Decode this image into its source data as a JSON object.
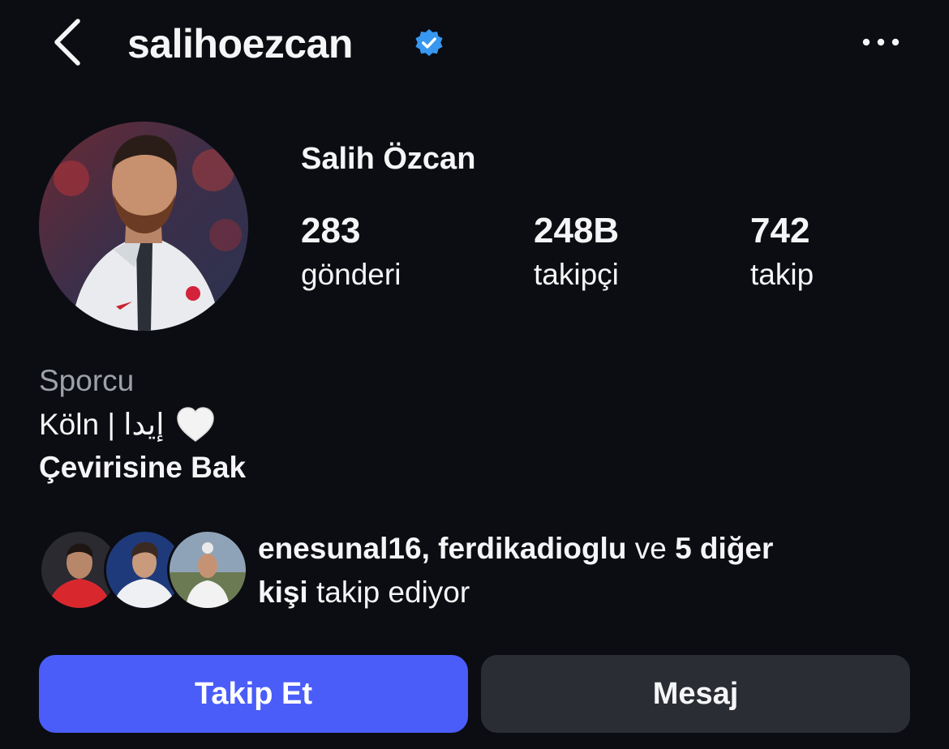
{
  "header": {
    "username": "salihoezcan",
    "back_icon": "chevron-left-icon",
    "verified_icon": "verified-badge-icon",
    "more_icon": "more-horizontal-icon"
  },
  "profile": {
    "full_name": "Salih Özcan",
    "stats": [
      {
        "value": "283",
        "label": "gönderi"
      },
      {
        "value": "248B",
        "label": "takipçi"
      },
      {
        "value": "742",
        "label": "takip"
      }
    ]
  },
  "bio": {
    "category": "Sporcu",
    "text": "Köln | إيدا",
    "heart_icon": "white-heart-icon",
    "translate_link": "Çevirisine Bak"
  },
  "mutual": {
    "user1": "enesunal16",
    "sep": ", ",
    "user2": "ferdikadioglu",
    "and": " ve ",
    "others": "5 diğer",
    "newline_bold": "kişi",
    "tail": " takip ediyor"
  },
  "actions": {
    "follow_label": "Takip Et",
    "message_label": "Mesaj"
  },
  "colors": {
    "background": "#0b0d12",
    "accent": "#4a5df9",
    "verified": "#3897f0",
    "secondary_button": "#2a2d34",
    "muted_text": "#9da1a8"
  }
}
